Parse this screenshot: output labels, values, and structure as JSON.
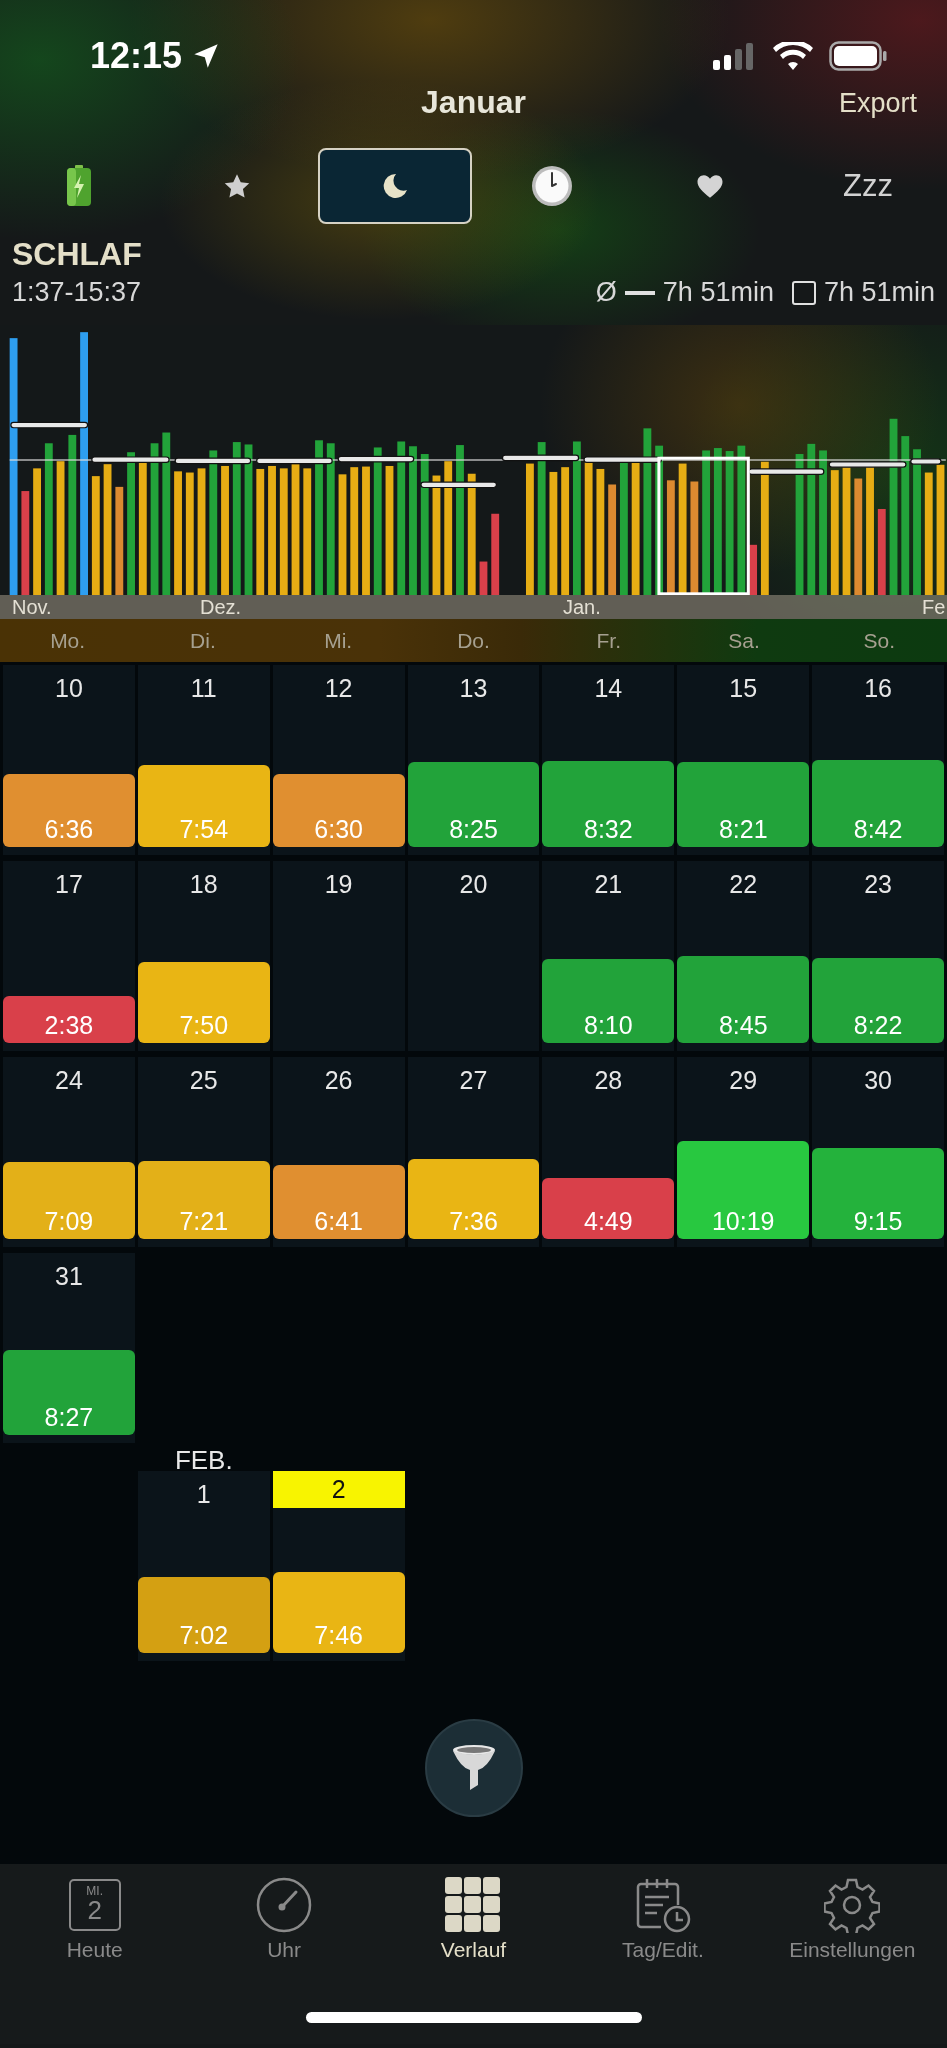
{
  "status_bar": {
    "time": "12:15"
  },
  "header": {
    "title": "Januar",
    "action": "Export"
  },
  "metric_tabs": [
    {
      "kind": "battery",
      "selected": false
    },
    {
      "kind": "star",
      "selected": false
    },
    {
      "kind": "moon",
      "selected": true
    },
    {
      "kind": "clock",
      "selected": false
    },
    {
      "kind": "heart",
      "selected": false
    },
    {
      "kind": "text",
      "label": "Zzz",
      "selected": false
    }
  ],
  "section": {
    "title": "SCHLAF",
    "range": "1:37-15:37",
    "legend": [
      {
        "kind": "line",
        "symbol": "Ø",
        "value": "7h 51min"
      },
      {
        "kind": "box",
        "value": "7h 51min"
      }
    ]
  },
  "chart": {
    "months": [
      "Nov.",
      "Dez.",
      "Jan.",
      "Fe"
    ]
  },
  "calendar": {
    "weekdays": [
      "Mo.",
      "Di.",
      "Mi.",
      "Do.",
      "Fr.",
      "Sa.",
      "So."
    ],
    "months": [
      {
        "weeks": [
          {
            "days": [
              {
                "kind": "day",
                "day": "10",
                "duration": "6:36",
                "color": "#e08f30",
                "today": false
              },
              {
                "kind": "day",
                "day": "11",
                "duration": "7:54",
                "color": "#e9b514",
                "today": false
              },
              {
                "kind": "day",
                "day": "12",
                "duration": "6:30",
                "color": "#e08f30",
                "today": false
              },
              {
                "kind": "day",
                "day": "13",
                "duration": "8:25",
                "color": "#22a33a",
                "today": false
              },
              {
                "kind": "day",
                "day": "14",
                "duration": "8:32",
                "color": "#22a33a",
                "today": false
              },
              {
                "kind": "day",
                "day": "15",
                "duration": "8:21",
                "color": "#22a33a",
                "today": false
              },
              {
                "kind": "day",
                "day": "16",
                "duration": "8:42",
                "color": "#22a33a",
                "today": false
              }
            ]
          },
          {
            "days": [
              {
                "kind": "day",
                "day": "17",
                "duration": "2:38",
                "color": "#d9404a",
                "today": false
              },
              {
                "kind": "day",
                "day": "18",
                "duration": "7:50",
                "color": "#e9b514",
                "today": false
              },
              {
                "kind": "day",
                "day": "19",
                "today": false
              },
              {
                "kind": "day",
                "day": "20",
                "today": false
              },
              {
                "kind": "day",
                "day": "21",
                "duration": "8:10",
                "color": "#22a33a",
                "today": false
              },
              {
                "kind": "day",
                "day": "22",
                "duration": "8:45",
                "color": "#22a33a",
                "today": false
              },
              {
                "kind": "day",
                "day": "23",
                "duration": "8:22",
                "color": "#22a33a",
                "today": false
              }
            ]
          },
          {
            "days": [
              {
                "kind": "day",
                "day": "24",
                "duration": "7:09",
                "color": "#e3b018",
                "today": false
              },
              {
                "kind": "day",
                "day": "25",
                "duration": "7:21",
                "color": "#e3b018",
                "today": false
              },
              {
                "kind": "day",
                "day": "26",
                "duration": "6:41",
                "color": "#e08f30",
                "today": false
              },
              {
                "kind": "day",
                "day": "27",
                "duration": "7:36",
                "color": "#e9b514",
                "today": false
              },
              {
                "kind": "day",
                "day": "28",
                "duration": "4:49",
                "color": "#d9404a",
                "today": false
              },
              {
                "kind": "day",
                "day": "29",
                "duration": "10:19",
                "color": "#28c840",
                "today": false
              },
              {
                "kind": "day",
                "day": "30",
                "duration": "9:15",
                "color": "#24b23c",
                "today": false
              }
            ]
          },
          {
            "days": [
              {
                "kind": "day",
                "day": "31",
                "duration": "8:27",
                "color": "#22a33a",
                "today": false
              }
            ]
          }
        ]
      },
      {
        "label": "FEB.",
        "weeks": [
          {
            "days": [
              {
                "kind": "blank"
              },
              {
                "kind": "day",
                "day": "1",
                "duration": "7:02",
                "color": "#d4a012",
                "today": false
              },
              {
                "kind": "day",
                "day": "2",
                "duration": "7:46",
                "color": "#e9b514",
                "today": true
              }
            ]
          }
        ]
      }
    ]
  },
  "tab_bar": [
    {
      "kind": "today",
      "label": "Heute",
      "weekday": "MI.",
      "date": "2",
      "selected": false
    },
    {
      "kind": "clock",
      "label": "Uhr",
      "selected": false
    },
    {
      "kind": "grid",
      "label": "Verlauf",
      "selected": true
    },
    {
      "kind": "edit",
      "label": "Tag/Edit.",
      "selected": false
    },
    {
      "kind": "settings",
      "label": "Einstellungen",
      "selected": false
    }
  ]
}
